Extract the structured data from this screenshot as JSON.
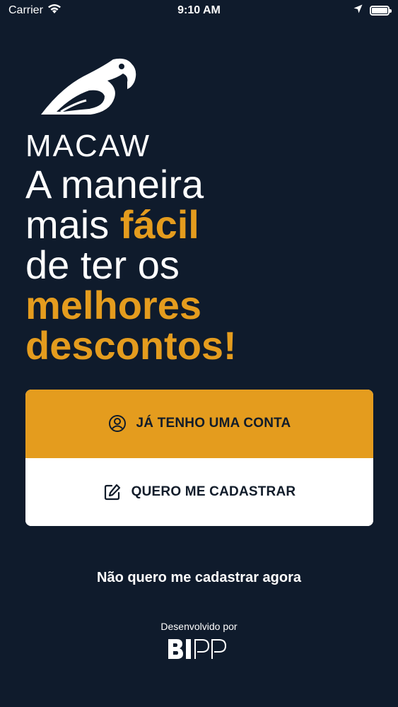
{
  "status_bar": {
    "carrier": "Carrier",
    "time": "9:10 AM"
  },
  "brand": {
    "name": "MACAW",
    "accent_color": "#e49c1e",
    "background_color": "#0f1b2c"
  },
  "headline": {
    "line1": "A maneira",
    "line2_prefix": "mais ",
    "line2_accent": "fácil",
    "line3": "de ter os",
    "line4": "melhores",
    "line5": "descontos!"
  },
  "actions": {
    "login_label": "JÁ TENHO UMA CONTA",
    "signup_label": "QUERO ME CADASTRAR",
    "skip_label": "Não quero me cadastrar agora"
  },
  "footer": {
    "developed_by": "Desenvolvido por",
    "developer_logo_text": "BIPP"
  },
  "icons": {
    "status": [
      "wifi-icon",
      "location-arrow-icon",
      "battery-icon"
    ],
    "login": "user-circle-icon",
    "signup": "edit-icon"
  }
}
